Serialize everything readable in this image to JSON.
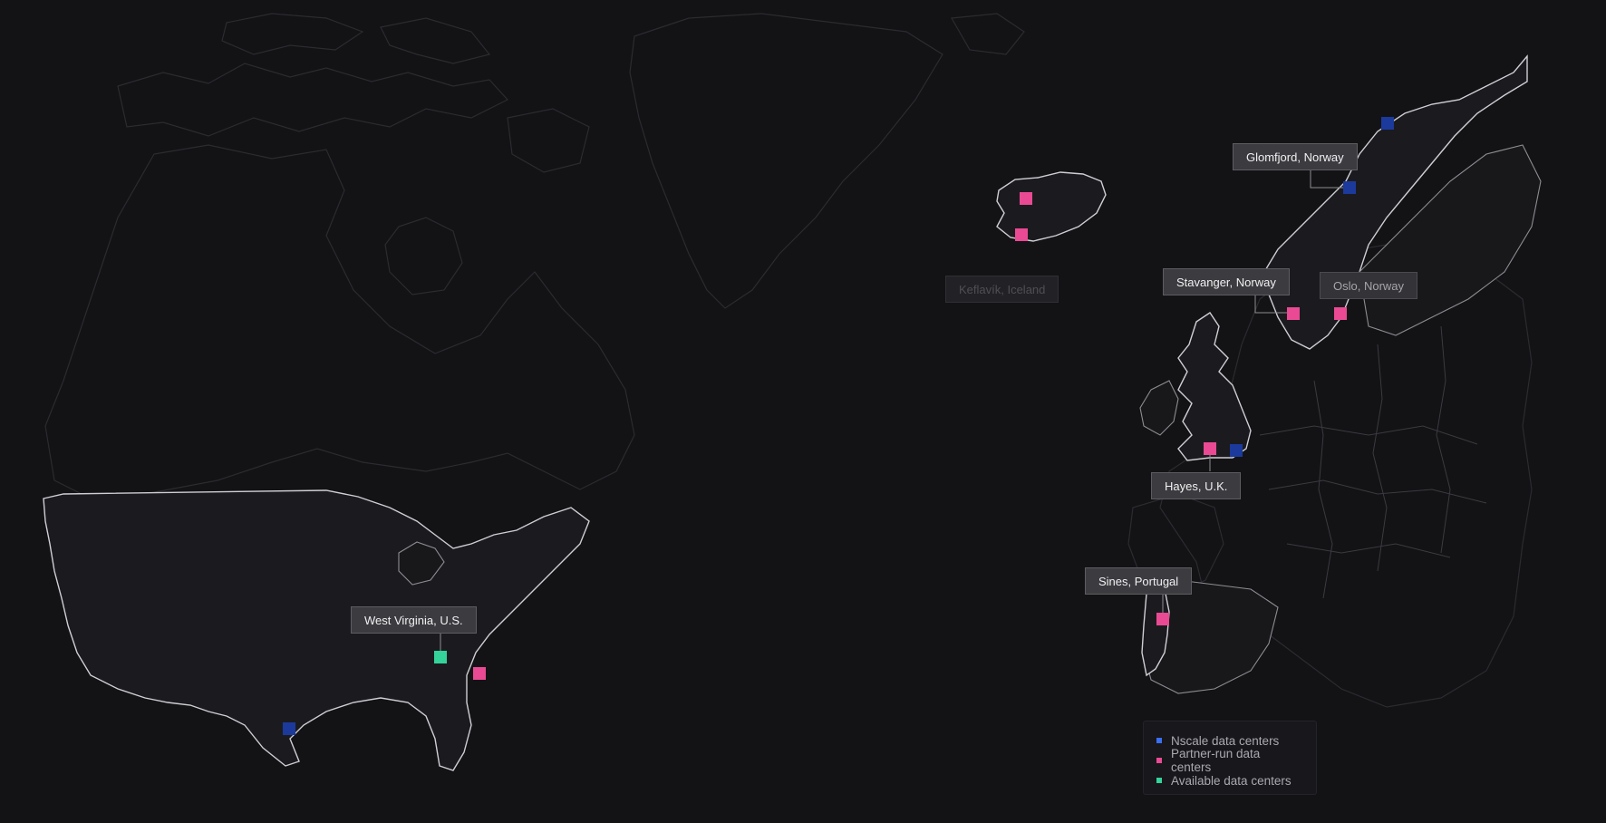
{
  "colors": {
    "background": "#131316",
    "nscale": "#1c3a9c",
    "partner": "#ea4a93",
    "available": "#34d39a"
  },
  "locations": [
    {
      "id": "glomfjord",
      "label": "Glomfjord, Norway"
    },
    {
      "id": "stavanger",
      "label": "Stavanger, Norway"
    },
    {
      "id": "oslo",
      "label": "Oslo, Norway"
    },
    {
      "id": "keflavik",
      "label": "Keflavík, Iceland"
    },
    {
      "id": "hayes",
      "label": "Hayes, U.K."
    },
    {
      "id": "sines",
      "label": "Sines, Portugal"
    },
    {
      "id": "west-virginia",
      "label": "West Virginia, U.S."
    }
  ],
  "markers": [
    {
      "region": "Northern Norway",
      "category": "nscale"
    },
    {
      "region": "Glomfjord, Norway",
      "category": "nscale"
    },
    {
      "region": "Stavanger, Norway",
      "category": "partner"
    },
    {
      "region": "Oslo, Norway",
      "category": "partner"
    },
    {
      "region": "Iceland (north-west)",
      "category": "partner"
    },
    {
      "region": "Keflavík, Iceland",
      "category": "partner"
    },
    {
      "region": "Hayes, U.K.",
      "category": "partner"
    },
    {
      "region": "London, U.K.",
      "category": "nscale"
    },
    {
      "region": "Sines, Portugal",
      "category": "partner"
    },
    {
      "region": "West Virginia, U.S.",
      "category": "available"
    },
    {
      "region": "North Carolina, U.S.",
      "category": "partner"
    },
    {
      "region": "Texas, U.S.",
      "category": "nscale"
    }
  ],
  "legend": {
    "items": [
      {
        "label": "Nscale data centers",
        "color": "#3b6ef0"
      },
      {
        "label": "Partner-run data centers",
        "color": "#ea4a93"
      },
      {
        "label": "Available data centers",
        "color": "#34d39a"
      }
    ]
  }
}
